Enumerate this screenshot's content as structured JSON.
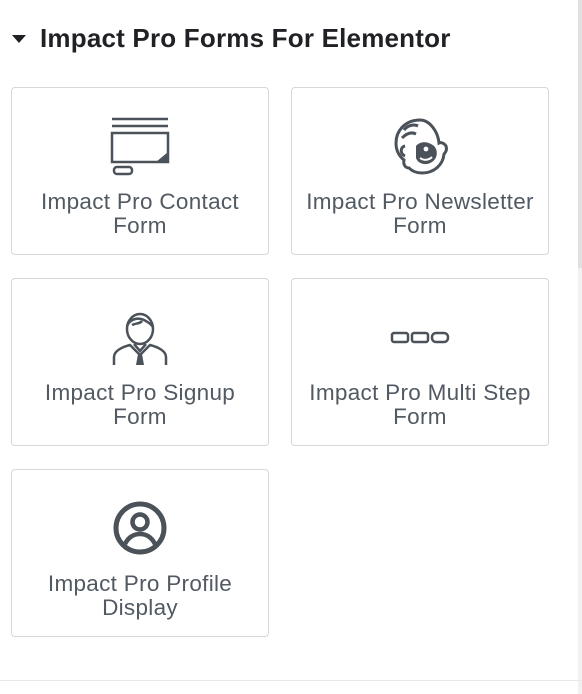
{
  "section": {
    "title": "Impact Pro Forms For Elementor",
    "expanded": true
  },
  "widgets": [
    {
      "label": "Impact Pro Contact Form",
      "icon": "contact-form-icon"
    },
    {
      "label": "Impact Pro Newsletter Form",
      "icon": "mailchimp-icon"
    },
    {
      "label": "Impact Pro Signup Form",
      "icon": "user-signup-icon"
    },
    {
      "label": "Impact Pro Multi Step Form",
      "icon": "multi-step-icon"
    },
    {
      "label": "Impact Pro Profile Display",
      "icon": "profile-icon"
    }
  ],
  "colors": {
    "icon": "#4b5259",
    "label": "#515962",
    "border": "#d5d8dc",
    "title": "#1f2124"
  }
}
